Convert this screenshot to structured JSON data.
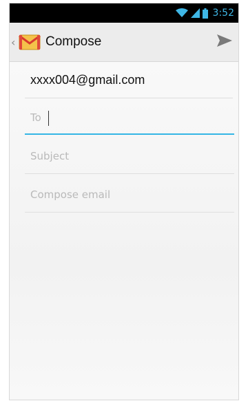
{
  "status_bar": {
    "time": "3:52",
    "icons": [
      "wifi-icon",
      "signal-icon",
      "battery-icon"
    ],
    "color": "#3fb7e6"
  },
  "action_bar": {
    "title": "Compose",
    "app_icon": "gmail-envelope-icon",
    "send_icon": "send-icon"
  },
  "compose": {
    "from": "xxxx004@gmail.com",
    "to_placeholder": "To",
    "to_value": "",
    "subject_placeholder": "Subject",
    "subject_value": "",
    "body_placeholder": "Compose email",
    "body_value": ""
  },
  "colors": {
    "accent": "#33b5e5",
    "status_bar_bg": "#000000"
  }
}
